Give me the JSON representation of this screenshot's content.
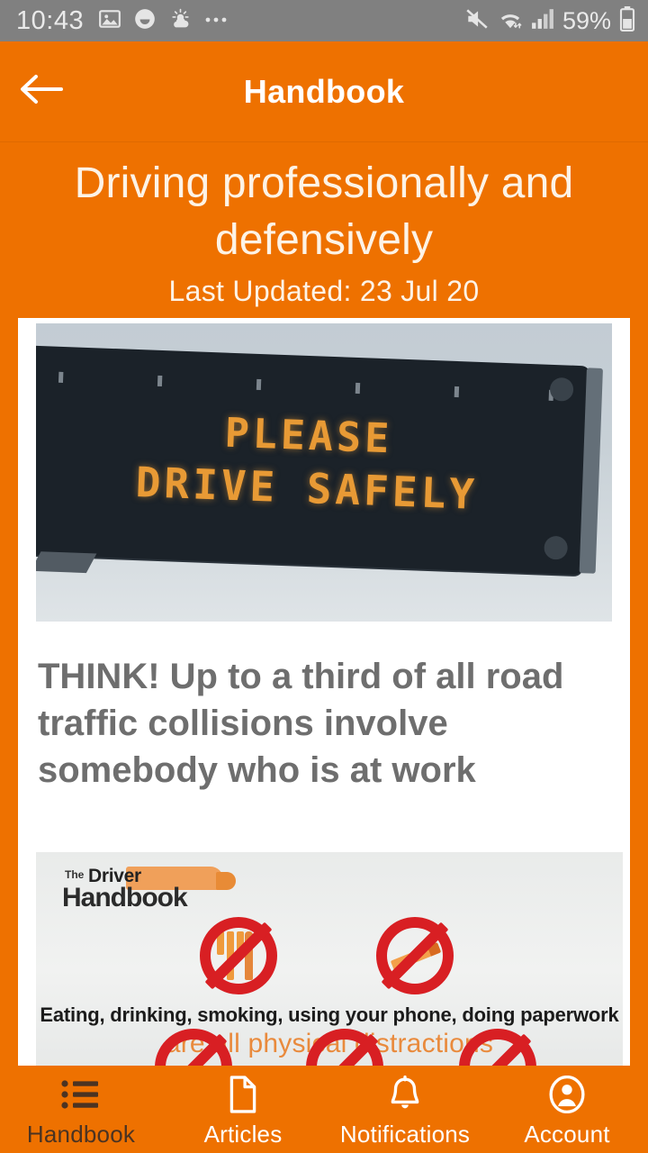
{
  "status_bar": {
    "time": "10:43",
    "battery_percent": "59%",
    "left_icons": [
      "image-icon",
      "smiley-icon",
      "weather-icon",
      "more-icon"
    ],
    "right_icons": [
      "mute-icon",
      "wifi-icon",
      "signal-icon",
      "battery-icon"
    ]
  },
  "app_bar": {
    "back_icon": "back-arrow-icon",
    "title": "Handbook"
  },
  "article": {
    "title": "Driving professionally and defensively",
    "last_updated": "Last Updated: 23 Jul 20",
    "hero_image": {
      "alt": "Overhead electronic highway sign",
      "sign_line_1": "PLEASE",
      "sign_line_2": "DRIVE SAFELY"
    },
    "lead": "THINK! Up to a third of all road traffic collisions involve somebody who is at work",
    "infographic": {
      "logo_the": "The",
      "logo_driver": "Driver",
      "logo_handbook": "Handbook",
      "caption_bold": "Eating, drinking, smoking, using your phone, doing paperwork",
      "caption_accent": "are all physical distractions",
      "prohibition_icons": [
        "no-eating-icon",
        "no-smoking-icon"
      ]
    }
  },
  "bottom_nav": {
    "items": [
      {
        "label": "Handbook",
        "icon": "list-icon",
        "active": true
      },
      {
        "label": "Articles",
        "icon": "document-icon",
        "active": false
      },
      {
        "label": "Notifications",
        "icon": "bell-icon",
        "active": false
      },
      {
        "label": "Account",
        "icon": "account-circle-icon",
        "active": false
      }
    ]
  },
  "colors": {
    "brand_orange": "#ee7100",
    "status_bar_gray": "#808080",
    "card_white": "#ffffff",
    "lead_text_gray": "#6e6e6e",
    "active_tab": "#4b3322",
    "prohibition_red": "#d81f23",
    "led_amber": "#e89a35"
  }
}
